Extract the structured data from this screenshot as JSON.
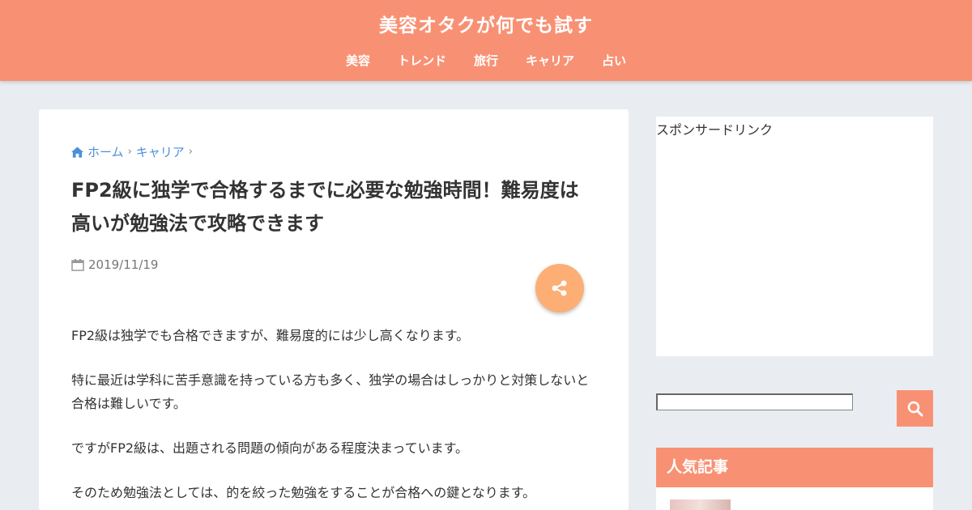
{
  "header": {
    "site_title": "美容オタクが何でも試す",
    "nav": [
      "美容",
      "トレンド",
      "旅行",
      "キャリア",
      "占い"
    ]
  },
  "breadcrumb": {
    "home": "ホーム",
    "category": "キャリア"
  },
  "article": {
    "title": "FP2級に独学で合格するまでに必要な勉強時間！難易度は高いが勉強法で攻略できます",
    "date": "2019/11/19",
    "paragraphs": [
      "FP2級は独学でも合格できますが、難易度的には少し高くなります。",
      "特に最近は学科に苦手意識を持っている方も多く、独学の場合はしっかりと対策しないと合格は難しいです。",
      "ですがFP2級は、出題される問題の傾向がある程度決まっています。",
      "そのため勉強法としては、的を絞った勉強をすることが合格への鍵となります。"
    ]
  },
  "sidebar": {
    "ad_label": "スポンサードリンク",
    "search_value": "",
    "popular_title": "人気記事"
  },
  "colors": {
    "header": "#f89174",
    "share_button": "#fcae74",
    "link": "#4a90d9",
    "background": "#e9edf1"
  },
  "icons": [
    "home-icon",
    "calendar-icon",
    "share-icon",
    "search-icon",
    "chevron-right-icon"
  ]
}
